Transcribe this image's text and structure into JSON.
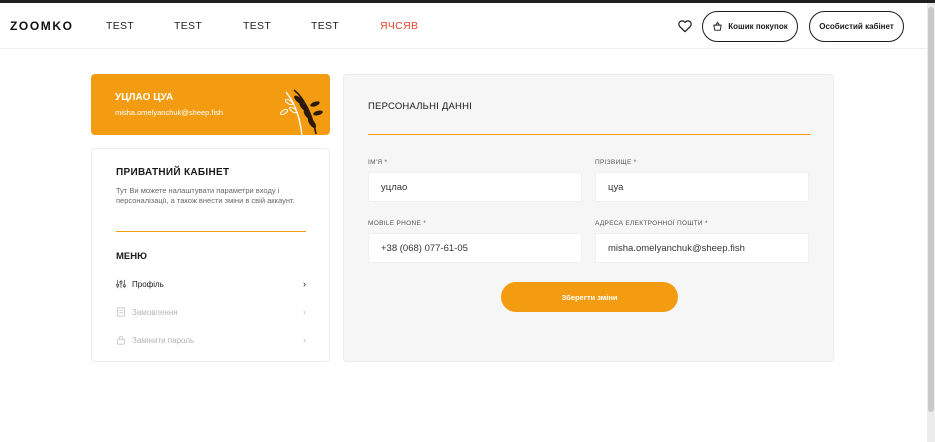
{
  "header": {
    "logo": "ZOOMKO",
    "nav": [
      {
        "label": "TEST"
      },
      {
        "label": "TEST"
      },
      {
        "label": "TEST"
      },
      {
        "label": "TEST"
      },
      {
        "label": "ЯЧСЯВ",
        "active": true
      }
    ],
    "cart_label": "Кошик покупок",
    "account_label": "Особистий кабінет",
    "icons": {
      "favorites": "heart-icon",
      "cart": "basket-icon"
    }
  },
  "user_card": {
    "name": "УЦЛАО ЦУА",
    "email": "misha.omelyanchuk@sheep.fish"
  },
  "sidebar": {
    "title": "ПРИВАТНИЙ КАБІНЕТ",
    "description": "Тут Ви можете налаштувати параметри входу і персоналізації, а також внести зміни в свій аккаунт.",
    "menu_title": "МЕНЮ",
    "items": [
      {
        "label": "Профіль",
        "icon": "sliders-icon",
        "active": true
      },
      {
        "label": "Замовлення",
        "icon": "orders-icon",
        "active": false
      },
      {
        "label": "Замінити пароль",
        "icon": "lock-icon",
        "active": false
      }
    ]
  },
  "form": {
    "title": "ПЕРСОНАЛЬНІ ДАННІ",
    "fields": {
      "first_name": {
        "label": "ІМ'Я *",
        "value": "уцлао"
      },
      "last_name": {
        "label": "ПРІЗВИЩЕ *",
        "value": "цуа"
      },
      "phone": {
        "label": "MOBILE PHONE *",
        "value": "+38 (068) 077-61-05"
      },
      "email": {
        "label": "АДРЕСА ЕЛЕКТРОННОЇ ПОШТИ *",
        "value": "misha.omelyanchuk@sheep.fish"
      }
    },
    "save_label": "Зберегти зміни"
  },
  "colors": {
    "accent": "#f39c12",
    "active_nav": "#e8452c"
  }
}
